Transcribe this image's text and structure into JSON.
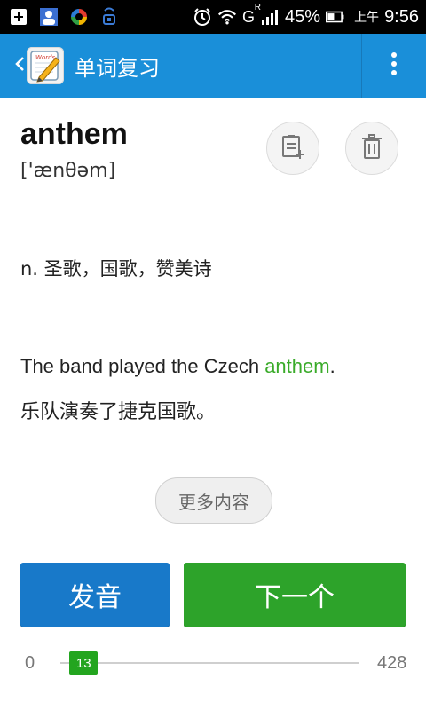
{
  "status_bar": {
    "battery_percent": "45%",
    "time_prefix": "上午",
    "time": "9:56",
    "signal_label": "G",
    "roaming_label": "R"
  },
  "app_bar": {
    "title": "单词复习",
    "back_icon": "chevron-left-icon",
    "logo_icon": "notebook-pencil-icon",
    "logo_text": "Words",
    "overflow_icon": "more-vertical-icon",
    "color": "#1a8fd9"
  },
  "word": {
    "text": "anthem",
    "phonetic": "['ænθəm]",
    "definition": "n. 圣歌，国歌，赞美诗",
    "example_en_before": "The band played the Czech ",
    "example_en_highlight": "anthem",
    "example_en_after": ".",
    "example_cn": "乐队演奏了捷克国歌。",
    "highlight_color": "#3aab2a"
  },
  "actions": {
    "add_note_icon": "add-note-icon",
    "delete_icon": "trash-icon",
    "more_label": "更多内容",
    "pronounce_label": "发音",
    "next_label": "下一个",
    "pronounce_color": "#1879c9",
    "next_color": "#2da32a"
  },
  "progress": {
    "min": "0",
    "max": "428",
    "current": "13",
    "current_value": 13,
    "total_value": 428
  }
}
